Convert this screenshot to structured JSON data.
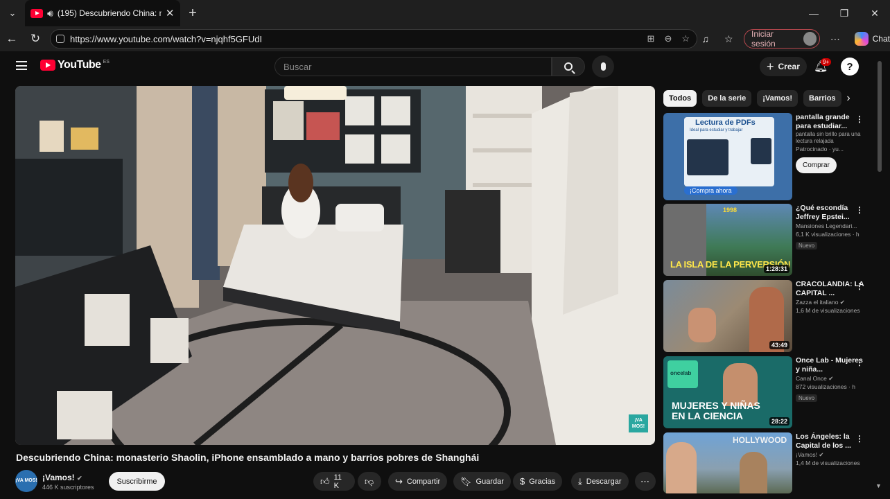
{
  "browser": {
    "tab_title": "(195) Descubriendo China: m",
    "url": "https://www.youtube.com/watch?v=njqhf5GFUdI",
    "signin_label": "Iniciar sesión",
    "copilot_label": "Chat"
  },
  "youtube": {
    "logo_text": "YouTube",
    "country_code": "ES",
    "search_placeholder": "Buscar",
    "create_label": "Crear",
    "notification_count": "9+"
  },
  "video": {
    "title": "Descubriendo China: monasterio Shaolin, iPhone ensamblado a mano y barrios pobres de Shanghái",
    "channel_name": "¡Vamos!",
    "channel_avatar_text": "¡VA MOS!",
    "subscribers": "446 K suscriptores",
    "subscribe_label": "Suscribirme",
    "watermark_text": "¡VA MOS!",
    "actions": {
      "likes": "11 K",
      "share": "Compartir",
      "save": "Guardar",
      "thanks": "Gracias",
      "download": "Descargar"
    }
  },
  "sidebar": {
    "chips": [
      "Todos",
      "De la serie",
      "¡Vamos!",
      "Barrios"
    ],
    "recommendations": [
      {
        "title": "pantalla grande para estudiar...",
        "meta1": "pantalla sin brillo para una lectura relajada",
        "meta2": "Patrocinado · yu...",
        "cta": "Comprar",
        "thumb_title": "Lectura de PDFs",
        "thumb_sub": "Ideal para estudiar y trabajar",
        "thumb_cta": "¡Compra ahora"
      },
      {
        "title": "¿Qué escondía Jeffrey Epstei...",
        "meta1": "Mansiones Legendari...",
        "meta2": "6,1 K visualizaciones · h",
        "badge": "Nuevo",
        "duration": "1:28:31",
        "thumb_text": "LA ISLA DE LA PERVERSIÓN",
        "thumb_year": "1998"
      },
      {
        "title": "CRACOLANDIA: LA CAPITAL ...",
        "meta1": "Zazza el italiano",
        "meta2": "1,6 M de visualizaciones",
        "duration": "43:49"
      },
      {
        "title": "Once Lab - Mujeres y niña...",
        "meta1": "Canal Once",
        "meta2": "872 visualizaciones · h",
        "badge": "Nuevo",
        "duration": "28:22",
        "thumb_text": "MUJERES Y NIÑAS EN LA CIENCIA",
        "thumb_logo": "oncelab"
      },
      {
        "title": "Los Ángeles: la Capital de los ...",
        "meta1": "¡Vamos!",
        "meta2": "1,4 M de visualizaciones",
        "thumb_text": "HOLLYWOOD"
      }
    ]
  },
  "colors": {
    "background": "#0f0f0f",
    "youtube_red": "#ff0033",
    "chrome_bar": "#1f1f1f",
    "chip_bg": "#272727"
  }
}
